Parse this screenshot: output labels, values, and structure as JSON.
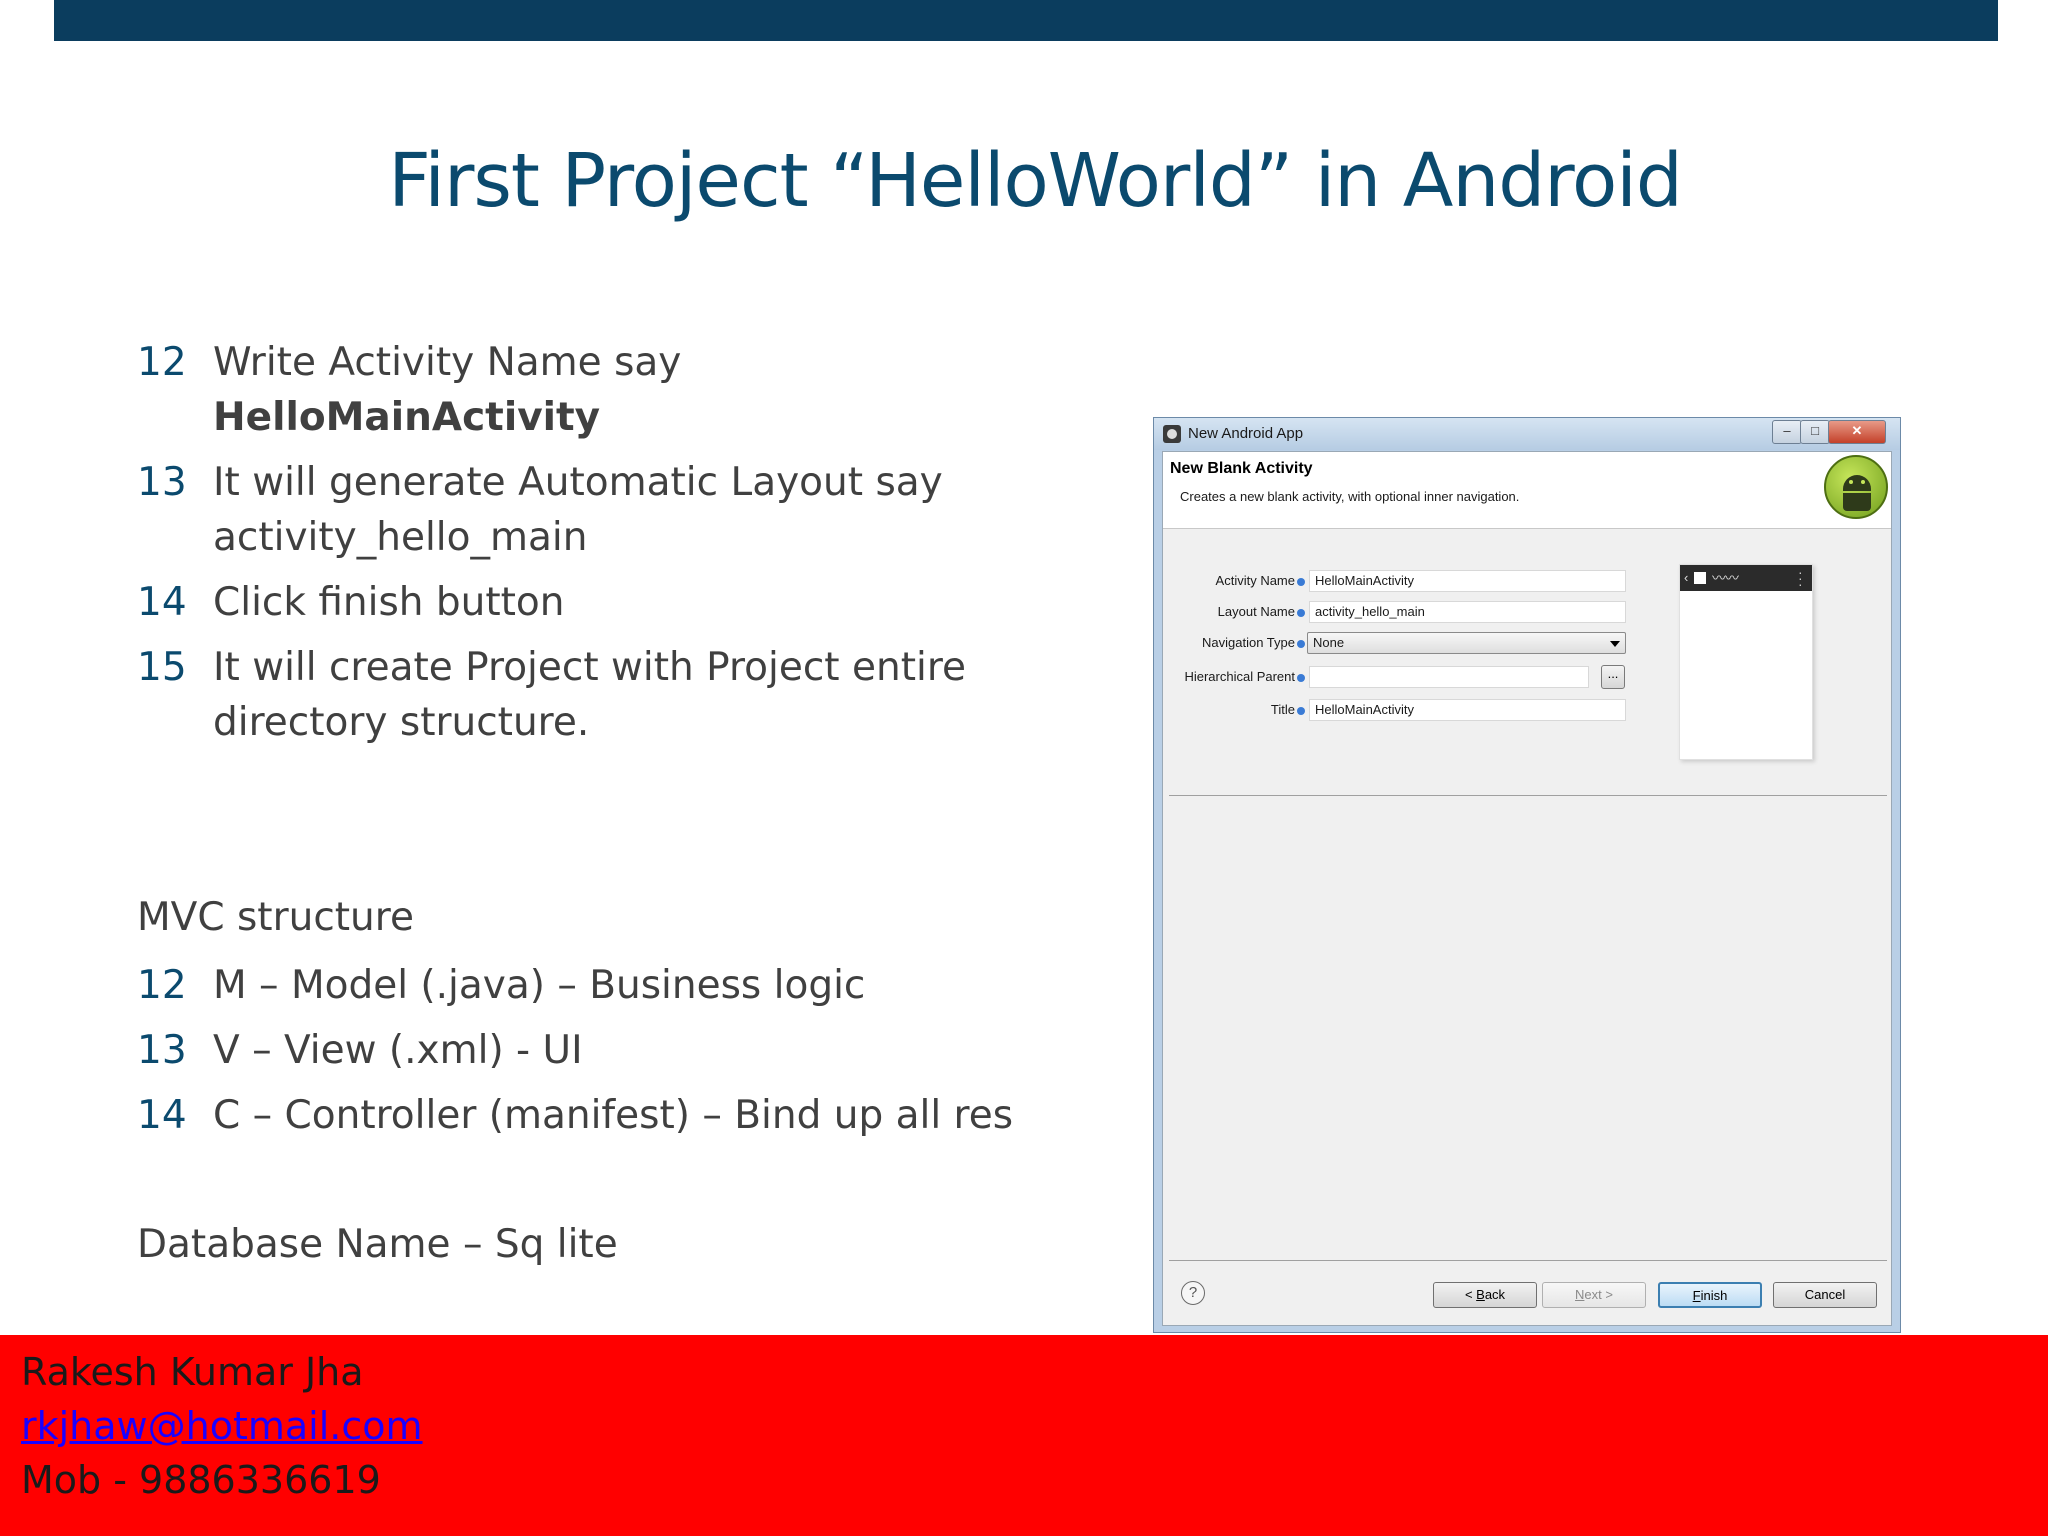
{
  "slide": {
    "title": "First Project “HelloWorld” in Android",
    "steps": [
      {
        "num": "12",
        "text": "Write Activity Name say",
        "bold": "HelloMainActivity"
      },
      {
        "num": "13",
        "text": "It will generate Automatic Layout say activity_hello_main"
      },
      {
        "num": "14",
        "text": "Click finish button"
      },
      {
        "num": "15",
        "text": "It will create Project with Project entire directory structure."
      }
    ],
    "mvc_heading": "MVC structure",
    "mvc_items": [
      {
        "num": "12",
        "text": "M – Model (.java) – Business logic"
      },
      {
        "num": "13",
        "text": "V – View (.xml) - UI"
      },
      {
        "num": "14",
        "text": "C – Controller (manifest) – Bind up all res"
      }
    ],
    "database_line": "Database Name – Sq lite"
  },
  "footer": {
    "name": "Rakesh Kumar Jha",
    "email": "rkjhaw@hotmail.com",
    "mobile": "Mob - 9886336619"
  },
  "dialog": {
    "window_title": "New Android App",
    "header_title": "New Blank Activity",
    "header_subtitle": "Creates a new blank activity, with optional inner navigation.",
    "fields": {
      "activity_name": {
        "label": "Activity Name",
        "value": "HelloMainActivity"
      },
      "layout_name": {
        "label": "Layout Name",
        "value": "activity_hello_main"
      },
      "navigation_type": {
        "label": "Navigation Type",
        "value": "None"
      },
      "hierarchical_parent": {
        "label": "Hierarchical Parent",
        "value": "",
        "browse_label": "..."
      },
      "title": {
        "label": "Title",
        "value": "HelloMainActivity"
      }
    },
    "buttons": {
      "back_accel": "B",
      "back_rest": "ack",
      "back_prefix": "< ",
      "next_accel": "N",
      "next_rest": "ext >",
      "finish_accel": "F",
      "finish_rest": "inish",
      "cancel": "Cancel"
    },
    "help_glyph": "?",
    "window_controls": {
      "minimize": "–",
      "maximize": "□",
      "close": "✕"
    }
  },
  "colors": {
    "top_bar": "#0b3d5e",
    "title": "#0b4a6e",
    "footer": "#ff0000",
    "link": "#1a00ff"
  }
}
